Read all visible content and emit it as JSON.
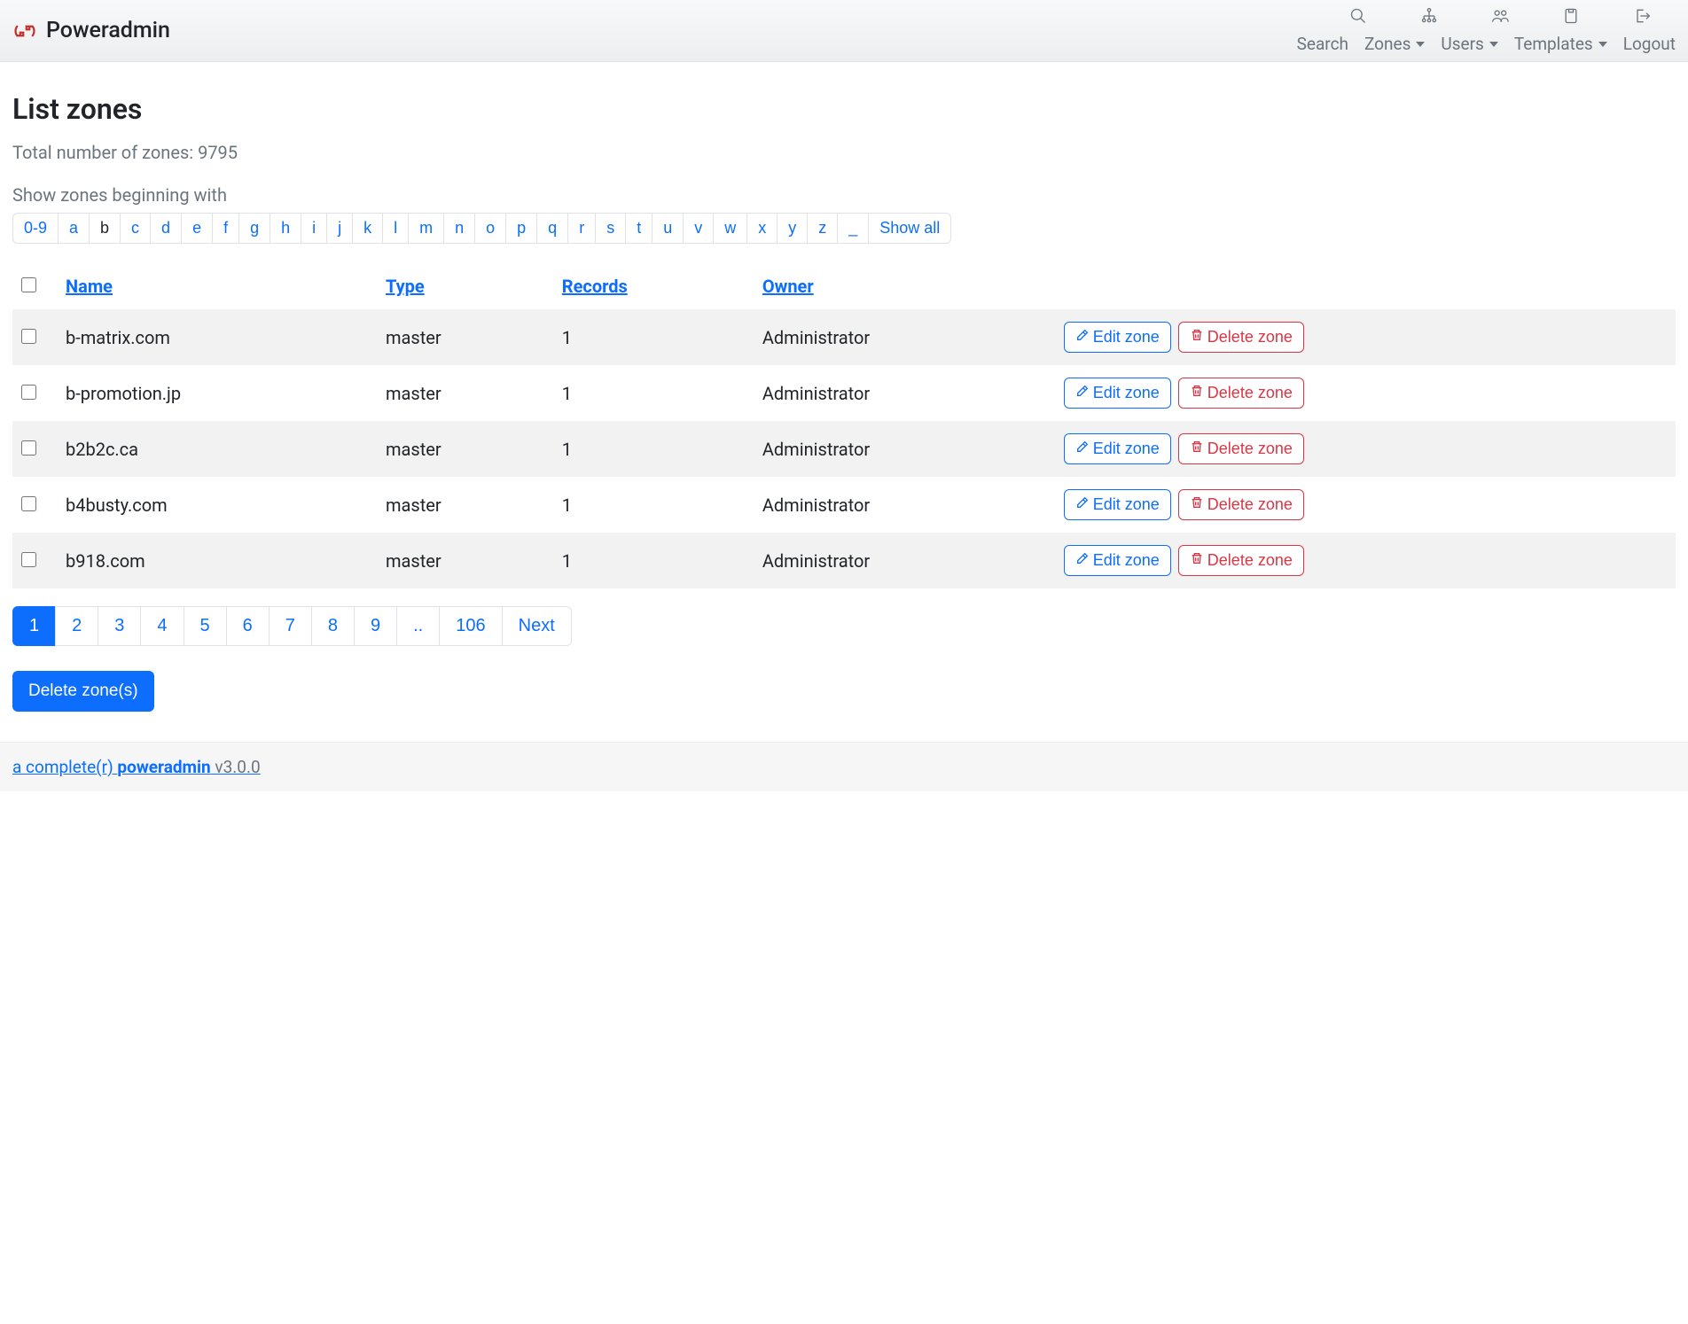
{
  "brand": {
    "name": "Poweradmin"
  },
  "nav": {
    "search": "Search",
    "zones": "Zones",
    "users": "Users",
    "templates": "Templates",
    "logout": "Logout"
  },
  "page": {
    "title": "List zones",
    "total_label": "Total number of zones: 9795",
    "filter_label": "Show zones beginning with"
  },
  "letters": [
    "0-9",
    "a",
    "b",
    "c",
    "d",
    "e",
    "f",
    "g",
    "h",
    "i",
    "j",
    "k",
    "l",
    "m",
    "n",
    "o",
    "p",
    "q",
    "r",
    "s",
    "t",
    "u",
    "v",
    "w",
    "x",
    "y",
    "z",
    "_",
    "Show all"
  ],
  "active_letter": "b",
  "table": {
    "headers": {
      "name": "Name",
      "type": "Type",
      "records": "Records",
      "owner": "Owner"
    },
    "edit_label": "Edit zone",
    "delete_label": "Delete zone",
    "rows": [
      {
        "name": "b-matrix.com",
        "type": "master",
        "records": "1",
        "owner": "Administrator"
      },
      {
        "name": "b-promotion.jp",
        "type": "master",
        "records": "1",
        "owner": "Administrator"
      },
      {
        "name": "b2b2c.ca",
        "type": "master",
        "records": "1",
        "owner": "Administrator"
      },
      {
        "name": "b4busty.com",
        "type": "master",
        "records": "1",
        "owner": "Administrator"
      },
      {
        "name": "b918.com",
        "type": "master",
        "records": "1",
        "owner": "Administrator"
      }
    ]
  },
  "pagination": {
    "pages": [
      "1",
      "2",
      "3",
      "4",
      "5",
      "6",
      "7",
      "8",
      "9",
      "..",
      "106",
      "Next"
    ],
    "active": "1"
  },
  "delete_button": "Delete zone(s)",
  "footer": {
    "link_text": "a complete(r) ",
    "bold": "poweradmin",
    "version": " v3.0.0"
  }
}
